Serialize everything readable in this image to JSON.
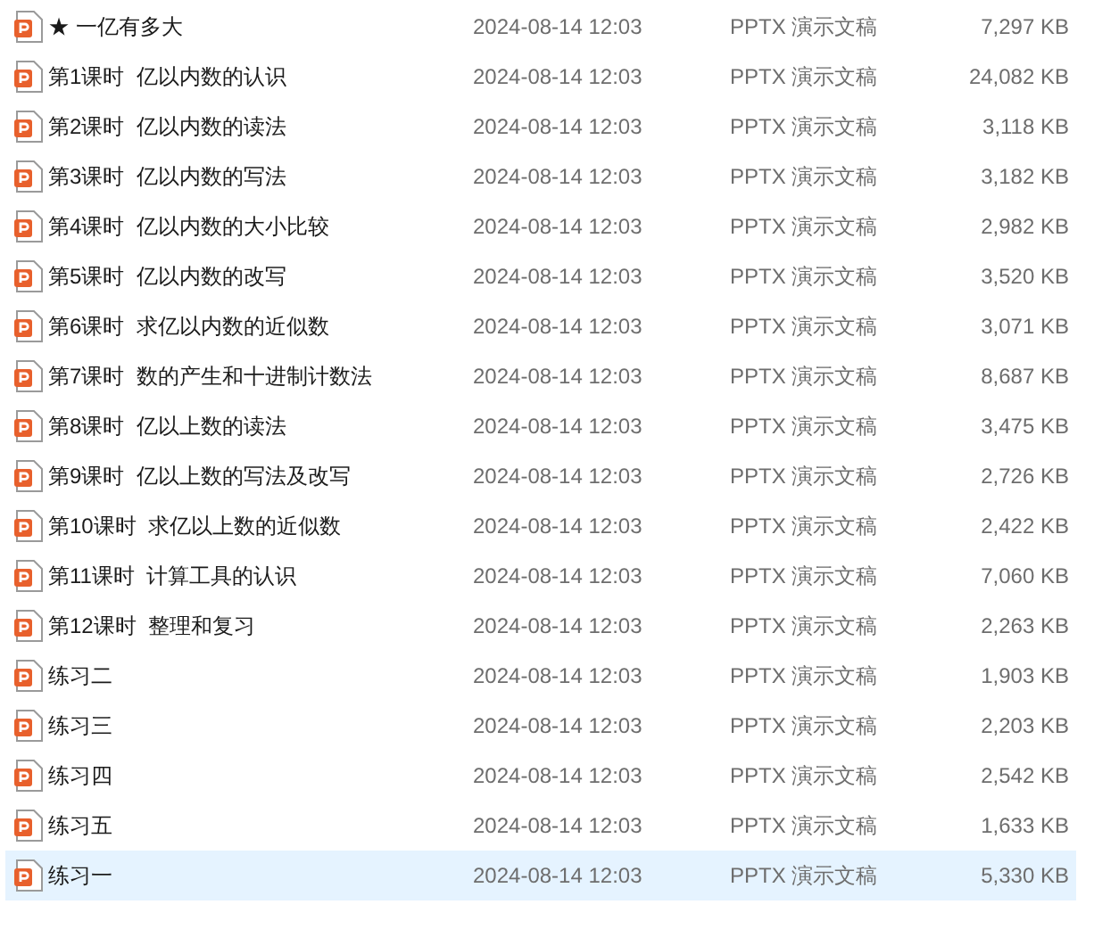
{
  "files": [
    {
      "name": "★ 一亿有多大",
      "date": "2024-08-14 12:03",
      "type": "PPTX 演示文稿",
      "size": "7,297 KB",
      "selected": false
    },
    {
      "name": "第1课时  亿以内数的认识",
      "date": "2024-08-14 12:03",
      "type": "PPTX 演示文稿",
      "size": "24,082 KB",
      "selected": false
    },
    {
      "name": "第2课时  亿以内数的读法",
      "date": "2024-08-14 12:03",
      "type": "PPTX 演示文稿",
      "size": "3,118 KB",
      "selected": false
    },
    {
      "name": "第3课时  亿以内数的写法",
      "date": "2024-08-14 12:03",
      "type": "PPTX 演示文稿",
      "size": "3,182 KB",
      "selected": false
    },
    {
      "name": "第4课时  亿以内数的大小比较",
      "date": "2024-08-14 12:03",
      "type": "PPTX 演示文稿",
      "size": "2,982 KB",
      "selected": false
    },
    {
      "name": "第5课时  亿以内数的改写",
      "date": "2024-08-14 12:03",
      "type": "PPTX 演示文稿",
      "size": "3,520 KB",
      "selected": false
    },
    {
      "name": "第6课时  求亿以内数的近似数",
      "date": "2024-08-14 12:03",
      "type": "PPTX 演示文稿",
      "size": "3,071 KB",
      "selected": false
    },
    {
      "name": "第7课时  数的产生和十进制计数法",
      "date": "2024-08-14 12:03",
      "type": "PPTX 演示文稿",
      "size": "8,687 KB",
      "selected": false
    },
    {
      "name": "第8课时  亿以上数的读法",
      "date": "2024-08-14 12:03",
      "type": "PPTX 演示文稿",
      "size": "3,475 KB",
      "selected": false
    },
    {
      "name": "第9课时  亿以上数的写法及改写",
      "date": "2024-08-14 12:03",
      "type": "PPTX 演示文稿",
      "size": "2,726 KB",
      "selected": false
    },
    {
      "name": "第10课时  求亿以上数的近似数",
      "date": "2024-08-14 12:03",
      "type": "PPTX 演示文稿",
      "size": "2,422 KB",
      "selected": false
    },
    {
      "name": "第11课时  计算工具的认识",
      "date": "2024-08-14 12:03",
      "type": "PPTX 演示文稿",
      "size": "7,060 KB",
      "selected": false
    },
    {
      "name": "第12课时  整理和复习",
      "date": "2024-08-14 12:03",
      "type": "PPTX 演示文稿",
      "size": "2,263 KB",
      "selected": false
    },
    {
      "name": "练习二",
      "date": "2024-08-14 12:03",
      "type": "PPTX 演示文稿",
      "size": "1,903 KB",
      "selected": false
    },
    {
      "name": "练习三",
      "date": "2024-08-14 12:03",
      "type": "PPTX 演示文稿",
      "size": "2,203 KB",
      "selected": false
    },
    {
      "name": "练习四",
      "date": "2024-08-14 12:03",
      "type": "PPTX 演示文稿",
      "size": "2,542 KB",
      "selected": false
    },
    {
      "name": "练习五",
      "date": "2024-08-14 12:03",
      "type": "PPTX 演示文稿",
      "size": "1,633 KB",
      "selected": false
    },
    {
      "name": "练习一",
      "date": "2024-08-14 12:03",
      "type": "PPTX 演示文稿",
      "size": "5,330 KB",
      "selected": true
    }
  ]
}
